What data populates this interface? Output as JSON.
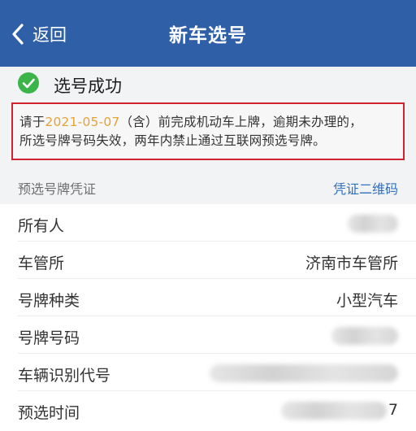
{
  "nav": {
    "back_label": "返回",
    "title": "新车选号"
  },
  "status": {
    "text": "选号成功",
    "icon": "check-circle-icon",
    "color": "#3bb54a"
  },
  "notice": {
    "prefix": "请于",
    "date": "2021-05-07",
    "suffix_line1": "（含）前完成机动车上牌，逾期未办理的，",
    "line2": "所选号牌号码失效，两年内禁止通过互联网预选号牌。"
  },
  "section": {
    "label": "预选号牌凭证",
    "link": "凭证二维码"
  },
  "rows": [
    {
      "label": "所有人"
    },
    {
      "label": "车管所",
      "value": "济南市车管所"
    },
    {
      "label": "号牌种类",
      "value": "小型汽车"
    },
    {
      "label": "号牌号码"
    },
    {
      "label": "车辆识别代号"
    },
    {
      "label": "预选时间",
      "value": "7"
    }
  ],
  "colors": {
    "navbar": "#2f5fa7",
    "notice_border": "#d3222f",
    "date_highlight": "#e3a33a",
    "link": "#2f6fc1"
  }
}
